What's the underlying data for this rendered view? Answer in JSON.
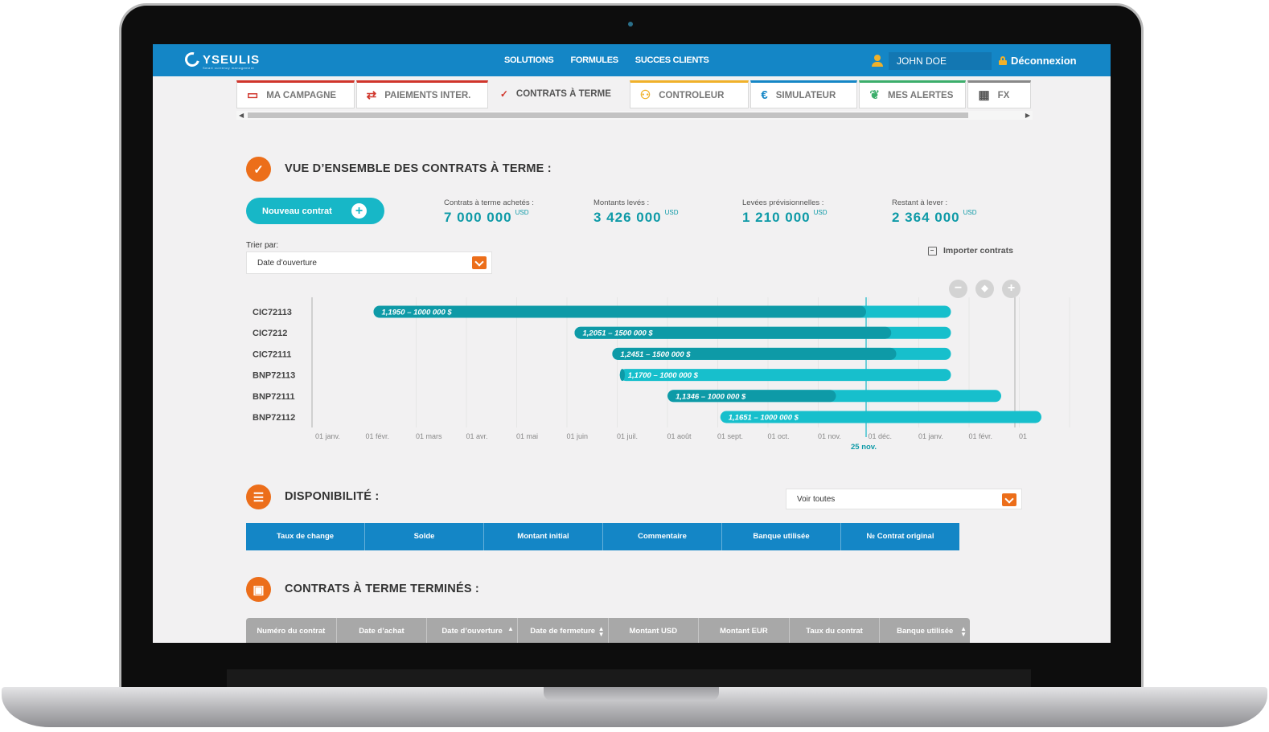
{
  "app": {
    "logo": "YSEULIS",
    "logo_sub": "Smart currency management"
  },
  "header": {
    "nav": [
      "SOLUTIONS",
      "FORMULES",
      "SUCCES CLIENTS"
    ],
    "user_name": "JOHN DOE",
    "logout": "Déconnexion"
  },
  "tabs": [
    {
      "label": "MA CAMPAGNE",
      "icon": "laptop-check-icon",
      "color": "#d0352b"
    },
    {
      "label": "PAIEMENTS INTER.",
      "icon": "transfer-arrows-icon",
      "color": "#d0352b"
    },
    {
      "label": "CONTRATS À TERME",
      "icon": "check-badge-icon",
      "color": "#d0352b"
    },
    {
      "label": "CONTROLEUR",
      "icon": "users-icon",
      "color": "#f0b12a"
    },
    {
      "label": "SIMULATEUR",
      "icon": "euro-icon",
      "color": "#1486c6"
    },
    {
      "label": "MES ALERTES",
      "icon": "leaf-icon",
      "color": "#3cae6b"
    },
    {
      "label": "FX",
      "icon": "calendar-icon",
      "color": "#555555"
    }
  ],
  "overview": {
    "title": "VUE D’ENSEMBLE DES CONTRATS À TERME :",
    "new_button": "Nouveau contrat",
    "stats": [
      {
        "label": "Contrats à terme achetés :",
        "value": "7 000 000",
        "unit": "USD"
      },
      {
        "label": "Montants levés :",
        "value": "3 426 000",
        "unit": "USD"
      },
      {
        "label": "Levées prévisionnelles :",
        "value": "1 210 000",
        "unit": "USD"
      },
      {
        "label": "Restant à lever :",
        "value": "2 364 000",
        "unit": "USD"
      }
    ],
    "sort_label": "Trier par:",
    "sort_value": "Date d’ouverture",
    "import_label": "Importer contrats"
  },
  "chart_data": {
    "type": "gantt",
    "x_ticks": [
      "01 janv.",
      "01 févr.",
      "01 mars",
      "01 avr.",
      "01 mai",
      "01 juin",
      "01 juil.",
      "01 août",
      "01 sept.",
      "01 oct.",
      "01 nov.",
      "01 déc.",
      "01 janv.",
      "01 févr.",
      "01"
    ],
    "today_label": "25 nov.",
    "today_month": 10.8,
    "rows": [
      {
        "name": "CIC72113",
        "label": "1,1950 – 1000 000 $",
        "start": 1.0,
        "progress_end": 10.8,
        "end": 12.2
      },
      {
        "name": "CIC7212",
        "label": "1,2051 – 1500 000 $",
        "start": 5.0,
        "progress_end": 11.3,
        "end": 12.2
      },
      {
        "name": "CIC72111",
        "label": "1,2451 – 1500 000 $",
        "start": 5.75,
        "progress_end": 11.4,
        "end": 12.2
      },
      {
        "name": "BNP72113",
        "label": "1,1700 – 1000 000 $",
        "start": 5.9,
        "progress_end": 6.0,
        "end": 12.2
      },
      {
        "name": "BNP72111",
        "label": "1,1346 – 1000 000 $",
        "start": 6.85,
        "progress_end": 10.2,
        "end": 13.2
      },
      {
        "name": "BNP72112",
        "label": "1,1651 – 1000 000 $",
        "start": 7.9,
        "progress_end": 7.95,
        "end": 14.0
      }
    ]
  },
  "availability": {
    "title": "DISPONIBILITÉ :",
    "filter_value": "Voir toutes",
    "columns": [
      "Taux de change",
      "Solde",
      "Montant initial",
      "Commentaire",
      "Banque utilisée",
      "№ Contrat original"
    ]
  },
  "finished": {
    "title": "CONTRATS À TERME TERMINÉS :",
    "columns": [
      {
        "label": "Numéro du contrat",
        "sortable": false
      },
      {
        "label": "Date d’achat",
        "sortable": false
      },
      {
        "label": "Date d’ouverture",
        "sortable": true
      },
      {
        "label": "Date de fermeture",
        "sortable": true
      },
      {
        "label": "Montant USD",
        "sortable": false
      },
      {
        "label": "Montant EUR",
        "sortable": false
      },
      {
        "label": "Taux du contrat",
        "sortable": false
      },
      {
        "label": "Banque utilisée",
        "sortable": true
      }
    ]
  },
  "colors": {
    "header_blue": "#1486c6",
    "accent_orange": "#ec6e1a",
    "teal": "#17b7c7",
    "teal_dark": "#0e9aa7"
  }
}
